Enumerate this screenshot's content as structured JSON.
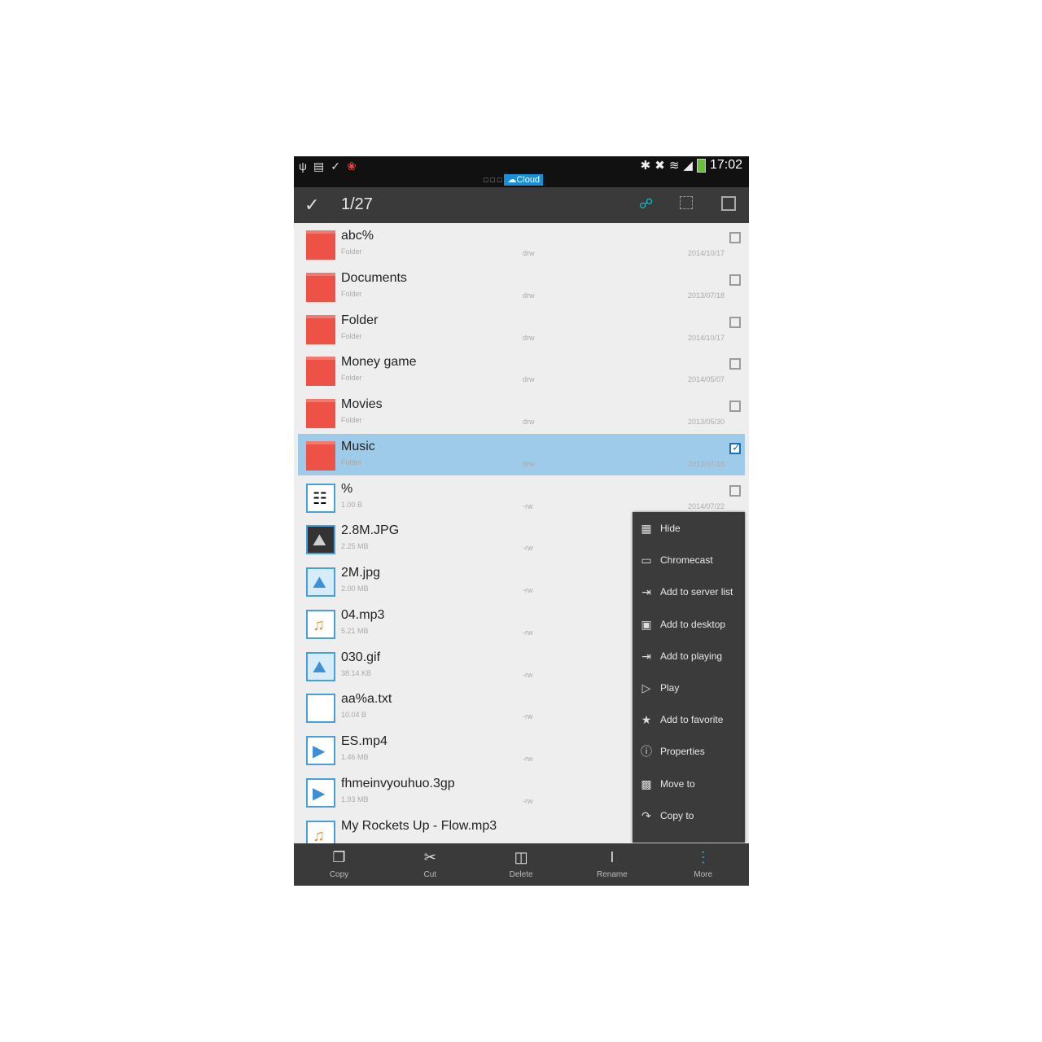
{
  "status_bar": {
    "time": "17:02",
    "notification_chip": "Cloud",
    "left_icons": [
      "usb-icon",
      "file-icon",
      "check-icon",
      "color-app-icon"
    ],
    "right_icons": [
      "bluetooth-icon",
      "mute-icon",
      "wifi-icon",
      "signal-icon",
      "battery-icon"
    ]
  },
  "action_bar": {
    "selection_count": "1/27"
  },
  "files": [
    {
      "name": "abc%",
      "sub": "Folder",
      "perm": "drw",
      "date": "2014/10/17",
      "type": "folder",
      "selected": false
    },
    {
      "name": "Documents",
      "sub": "Folder",
      "perm": "drw",
      "date": "2013/07/18",
      "type": "folder",
      "selected": false
    },
    {
      "name": "Folder",
      "sub": "Folder",
      "perm": "drw",
      "date": "2014/10/17",
      "type": "folder",
      "selected": false
    },
    {
      "name": "Money game",
      "sub": "Folder",
      "perm": "drw",
      "date": "2014/05/07",
      "type": "folder",
      "selected": false
    },
    {
      "name": "Movies",
      "sub": "Folder",
      "perm": "drw",
      "date": "2013/05/30",
      "type": "folder",
      "selected": false
    },
    {
      "name": "Music",
      "sub": "Folder",
      "perm": "drw",
      "date": "2013/07/18",
      "type": "folder",
      "selected": true
    },
    {
      "name": "%",
      "sub": "1.00 B",
      "perm": "-rw",
      "date": "2014/07/22",
      "type": "file",
      "selected": false
    },
    {
      "name": "2.8M.JPG",
      "sub": "2.25 MB",
      "perm": "-rw",
      "date": "",
      "type": "photo",
      "selected": false
    },
    {
      "name": "2M.jpg",
      "sub": "2.00 MB",
      "perm": "-rw",
      "date": "",
      "type": "image",
      "selected": false
    },
    {
      "name": "04.mp3",
      "sub": "5.21 MB",
      "perm": "-rw",
      "date": "",
      "type": "music",
      "selected": false
    },
    {
      "name": "030.gif",
      "sub": "38.14 KB",
      "perm": "-rw",
      "date": "",
      "type": "image",
      "selected": false
    },
    {
      "name": "aa%a.txt",
      "sub": "10.04 B",
      "perm": "-rw",
      "date": "",
      "type": "text",
      "selected": false
    },
    {
      "name": "ES.mp4",
      "sub": "1.46 MB",
      "perm": "-rw",
      "date": "",
      "type": "video",
      "selected": false
    },
    {
      "name": "fhmeinvyouhuo.3gp",
      "sub": "1.93 MB",
      "perm": "-rw",
      "date": "",
      "type": "video",
      "selected": false
    },
    {
      "name": "My Rockets Up - Flow.mp3",
      "sub": "",
      "perm": "",
      "date": "",
      "type": "music",
      "selected": false
    }
  ],
  "menu": [
    {
      "label": "Hide",
      "icon": "hide-folder-icon"
    },
    {
      "label": "Chromecast",
      "icon": "cast-icon"
    },
    {
      "label": "Add to server list",
      "icon": "add-server-icon"
    },
    {
      "label": "Add to desktop",
      "icon": "add-desktop-icon"
    },
    {
      "label": "Add to playing",
      "icon": "add-playing-icon"
    },
    {
      "label": "Play",
      "icon": "play-icon"
    },
    {
      "label": "Add to favorite",
      "icon": "star-icon"
    },
    {
      "label": "Properties",
      "icon": "info-icon"
    },
    {
      "label": "Move to",
      "icon": "move-icon"
    },
    {
      "label": "Copy to",
      "icon": "copy-to-icon"
    }
  ],
  "bottom_bar": [
    {
      "label": "Copy",
      "icon": "copy-icon"
    },
    {
      "label": "Cut",
      "icon": "scissors-icon"
    },
    {
      "label": "Delete",
      "icon": "trash-icon"
    },
    {
      "label": "Rename",
      "icon": "rename-icon"
    },
    {
      "label": "More",
      "icon": "more-vertical-icon"
    }
  ],
  "colors": {
    "selected_row": "#9fcbea",
    "folder": "#ee5247",
    "accent": "#1a8fd8"
  }
}
